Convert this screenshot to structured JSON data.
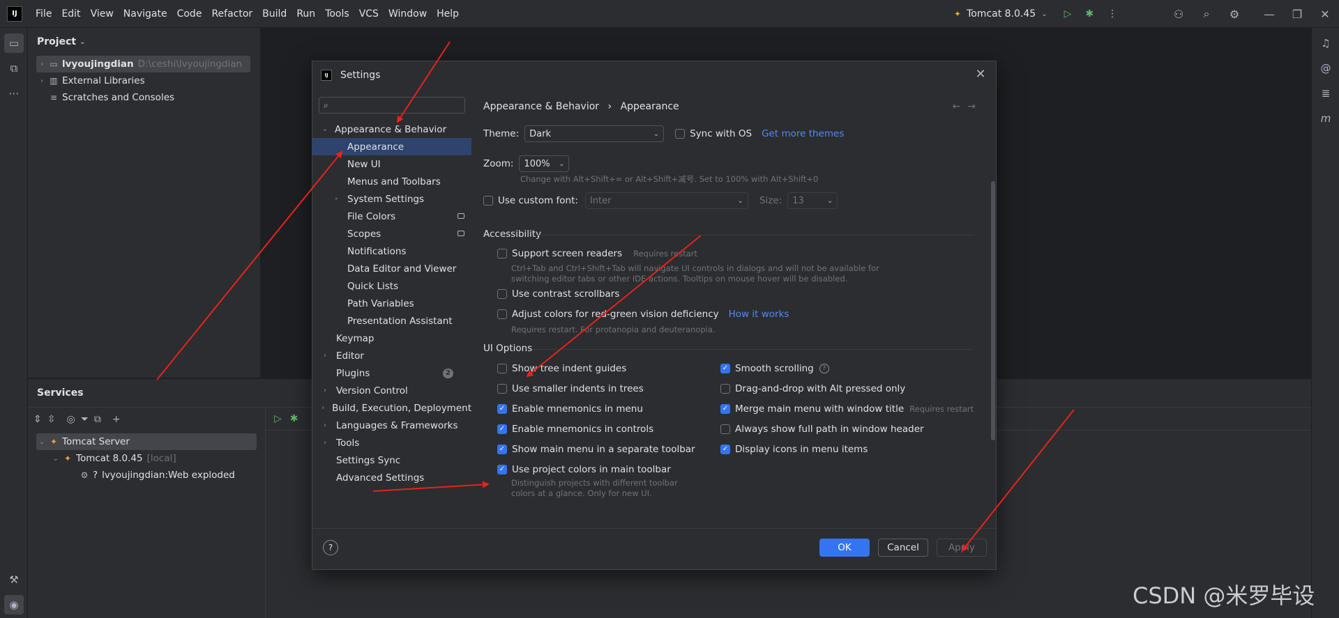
{
  "menubar": {
    "logo": "IJ",
    "items": [
      "File",
      "Edit",
      "View",
      "Navigate",
      "Code",
      "Refactor",
      "Build",
      "Run",
      "Tools",
      "VCS",
      "Window",
      "Help"
    ],
    "run_config": "Tomcat 8.0.45"
  },
  "project": {
    "title": "Project",
    "tree": [
      {
        "label": "lvyoujingdian",
        "path": "D:\\ceshi\\lvyoujingdian"
      },
      {
        "label": "External Libraries"
      },
      {
        "label": "Scratches and Consoles"
      }
    ]
  },
  "services": {
    "title": "Services",
    "tree": [
      {
        "label": "Tomcat Server"
      },
      {
        "label": "Tomcat 8.0.45",
        "tag": "[local]"
      },
      {
        "label": "lvyoujingdian:Web exploded"
      }
    ]
  },
  "settings": {
    "title": "Settings",
    "search_placeholder": "",
    "nav": [
      {
        "label": "Appearance & Behavior"
      },
      {
        "label": "Appearance"
      },
      {
        "label": "New UI"
      },
      {
        "label": "Menus and Toolbars"
      },
      {
        "label": "System Settings"
      },
      {
        "label": "File Colors"
      },
      {
        "label": "Scopes"
      },
      {
        "label": "Notifications"
      },
      {
        "label": "Data Editor and Viewer"
      },
      {
        "label": "Quick Lists"
      },
      {
        "label": "Path Variables"
      },
      {
        "label": "Presentation Assistant"
      },
      {
        "label": "Keymap"
      },
      {
        "label": "Editor"
      },
      {
        "label": "Plugins",
        "badge": "2"
      },
      {
        "label": "Version Control"
      },
      {
        "label": "Build, Execution, Deployment"
      },
      {
        "label": "Languages & Frameworks"
      },
      {
        "label": "Tools"
      },
      {
        "label": "Settings Sync"
      },
      {
        "label": "Advanced Settings"
      }
    ],
    "breadcrumb": {
      "parent": "Appearance & Behavior",
      "sep": "›",
      "current": "Appearance"
    },
    "theme": {
      "label": "Theme:",
      "value": "Dark",
      "sync_label": "Sync with OS",
      "more_link": "Get more themes"
    },
    "zoom": {
      "label": "Zoom:",
      "value": "100%",
      "hint": "Change with Alt+Shift+= or Alt+Shift+减号. Set to 100% with Alt+Shift+0"
    },
    "custom_font": {
      "label": "Use custom font:",
      "font_value": "Inter",
      "size_label": "Size:",
      "size_value": "13"
    },
    "accessibility": {
      "title": "Accessibility",
      "screen_readers": "Support screen readers",
      "screen_readers_req": "Requires restart",
      "screen_readers_hint1": "Ctrl+Tab and Ctrl+Shift+Tab will navigate UI controls in dialogs and will not be available for",
      "screen_readers_hint2": "switching editor tabs or other IDE actions. Tooltips on mouse hover will be disabled.",
      "contrast_scrollbars": "Use contrast scrollbars",
      "red_green": "Adjust colors for red-green vision deficiency",
      "how_it_works": "How it works",
      "red_green_hint": "Requires restart. For protanopia and deuteranopia."
    },
    "ui_options": {
      "title": "UI Options",
      "left": [
        {
          "label": "Show tree indent guides",
          "checked": false
        },
        {
          "label": "Use smaller indents in trees",
          "checked": false
        },
        {
          "label": "Enable mnemonics in menu",
          "checked": true
        },
        {
          "label": "Enable mnemonics in controls",
          "checked": true
        },
        {
          "label": "Show main menu in a separate toolbar",
          "checked": true
        },
        {
          "label": "Use project colors in main toolbar",
          "checked": true
        }
      ],
      "project_colors_hint1": "Distinguish projects with different toolbar",
      "project_colors_hint2": "colors at a glance. Only for new UI.",
      "right": [
        {
          "label": "Smooth scrolling",
          "checked": true
        },
        {
          "label": "Drag-and-drop with Alt pressed only",
          "checked": false
        },
        {
          "label": "Merge main menu with window title",
          "checked": true,
          "note": "Requires restart"
        },
        {
          "label": "Always show full path in window header",
          "checked": false
        },
        {
          "label": "Display icons in menu items",
          "checked": true
        }
      ]
    },
    "buttons": {
      "ok": "OK",
      "cancel": "Cancel",
      "apply": "Apply",
      "help": "?"
    }
  },
  "watermark": "CSDN @米罗毕设",
  "colors": {
    "accent": "#3574f0",
    "annotation_arrow": "#e8231a",
    "selection": "#2e436e"
  }
}
